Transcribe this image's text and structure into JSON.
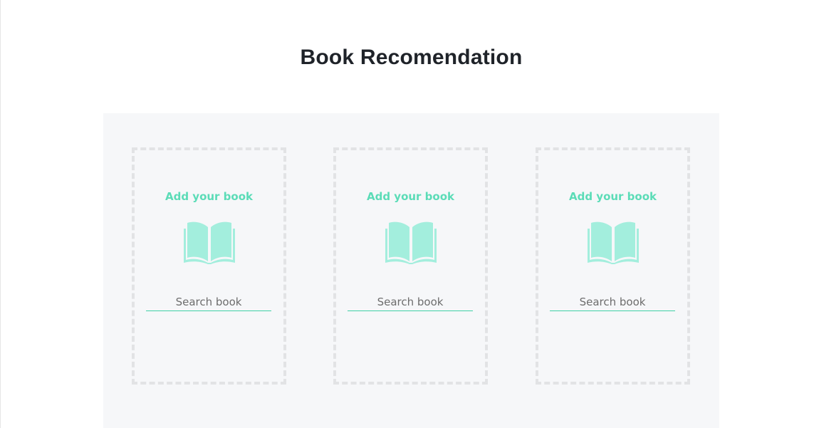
{
  "page": {
    "title": "Book Recomendation"
  },
  "cards": [
    {
      "heading": "Add your book",
      "icon": "open-book-icon",
      "search_placeholder": "Search book",
      "search_value": ""
    },
    {
      "heading": "Add your book",
      "icon": "open-book-icon",
      "search_placeholder": "Search book",
      "search_value": ""
    },
    {
      "heading": "Add your book",
      "icon": "open-book-icon",
      "search_placeholder": "Search book",
      "search_value": ""
    }
  ],
  "colors": {
    "accent": "#5bdcb7",
    "icon": "#a3eedd",
    "underline": "#3fd0a6",
    "panel_bg": "#f6f7f9",
    "dashed_border": "#e2e3e5",
    "title": "#1f2329"
  }
}
